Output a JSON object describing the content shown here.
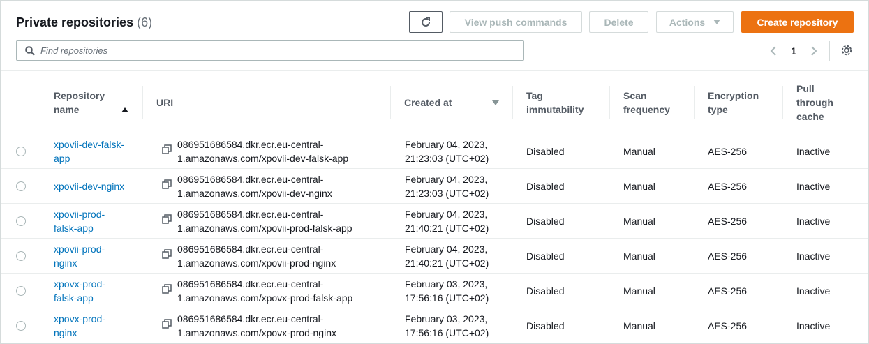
{
  "header": {
    "title": "Private repositories",
    "count": "(6)",
    "buttons": {
      "refresh_icon": "refresh-icon",
      "view_push_commands": "View push commands",
      "delete": "Delete",
      "actions": "Actions",
      "create_repository": "Create repository"
    },
    "accent_color": "#ec7211"
  },
  "search": {
    "placeholder": "Find repositories"
  },
  "pagination": {
    "current_page": "1"
  },
  "table": {
    "columns": {
      "name": [
        "Repository",
        "name"
      ],
      "uri": "URI",
      "created_at": "Created at",
      "tag_immutability": [
        "Tag",
        "immutability"
      ],
      "scan_frequency": [
        "Scan",
        "frequency"
      ],
      "encryption_type": [
        "Encryption",
        "type"
      ],
      "pull_through_cache": [
        "Pull",
        "through",
        "cache"
      ]
    },
    "rows": [
      {
        "name": [
          "xpovii-dev-falsk-",
          "app"
        ],
        "uri": [
          "086951686584.dkr.ecr.eu-central-",
          "1.amazonaws.com/xpovii-dev-falsk-app"
        ],
        "created": [
          "February 04, 2023,",
          "21:23:03 (UTC+02)"
        ],
        "tag": "Disabled",
        "scan": "Manual",
        "enc": "AES-256",
        "cache": "Inactive"
      },
      {
        "name": [
          "xpovii-dev-nginx"
        ],
        "uri": [
          "086951686584.dkr.ecr.eu-central-",
          "1.amazonaws.com/xpovii-dev-nginx"
        ],
        "created": [
          "February 04, 2023,",
          "21:23:03 (UTC+02)"
        ],
        "tag": "Disabled",
        "scan": "Manual",
        "enc": "AES-256",
        "cache": "Inactive"
      },
      {
        "name": [
          "xpovii-prod-",
          "falsk-app"
        ],
        "uri": [
          "086951686584.dkr.ecr.eu-central-",
          "1.amazonaws.com/xpovii-prod-falsk-app"
        ],
        "created": [
          "February 04, 2023,",
          "21:40:21 (UTC+02)"
        ],
        "tag": "Disabled",
        "scan": "Manual",
        "enc": "AES-256",
        "cache": "Inactive"
      },
      {
        "name": [
          "xpovii-prod-",
          "nginx"
        ],
        "uri": [
          "086951686584.dkr.ecr.eu-central-",
          "1.amazonaws.com/xpovii-prod-nginx"
        ],
        "created": [
          "February 04, 2023,",
          "21:40:21 (UTC+02)"
        ],
        "tag": "Disabled",
        "scan": "Manual",
        "enc": "AES-256",
        "cache": "Inactive"
      },
      {
        "name": [
          "xpovx-prod-",
          "falsk-app"
        ],
        "uri": [
          "086951686584.dkr.ecr.eu-central-",
          "1.amazonaws.com/xpovx-prod-falsk-app"
        ],
        "created": [
          "February 03, 2023,",
          "17:56:16 (UTC+02)"
        ],
        "tag": "Disabled",
        "scan": "Manual",
        "enc": "AES-256",
        "cache": "Inactive"
      },
      {
        "name": [
          "xpovx-prod-",
          "nginx"
        ],
        "uri": [
          "086951686584.dkr.ecr.eu-central-",
          "1.amazonaws.com/xpovx-prod-nginx"
        ],
        "created": [
          "February 03, 2023,",
          "17:56:16 (UTC+02)"
        ],
        "tag": "Disabled",
        "scan": "Manual",
        "enc": "AES-256",
        "cache": "Inactive"
      }
    ]
  }
}
